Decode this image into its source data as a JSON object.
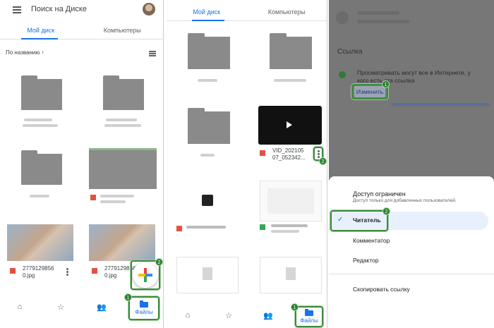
{
  "panel1": {
    "search_placeholder": "Поиск на Диске",
    "tabs": [
      "Мой диск",
      "Компьютеры"
    ],
    "sort_label": "По названию ↑",
    "files": [
      {
        "name": "2779129856\n0.jpg"
      },
      {
        "name": "2779129856\n0.jpg"
      }
    ],
    "files_nav_label": "Файлы",
    "badges": [
      "2",
      "1"
    ]
  },
  "panel2": {
    "tabs": [
      "Мой диск",
      "Компьютеры"
    ],
    "video_name": "VID_202105\n07_052342...",
    "files_nav_label": "Файлы",
    "badges": [
      "2",
      "1"
    ]
  },
  "panel3": {
    "section_title": "Ссылка",
    "description": "Просматривать могут все в Интернете, у кого есть эта ссылка",
    "change_label": "Изменить",
    "sheet_title": "Доступ ограничен",
    "sheet_subtitle": "Доступ только для добавленных пользователей.",
    "options": [
      "Читатель",
      "Комментатор",
      "Редактор"
    ],
    "copy_link": "Скопировать ссылку",
    "badges": [
      "1",
      "2"
    ]
  },
  "colors": {
    "accent": "#1a73e8",
    "highlight": "#3a8a3a"
  }
}
